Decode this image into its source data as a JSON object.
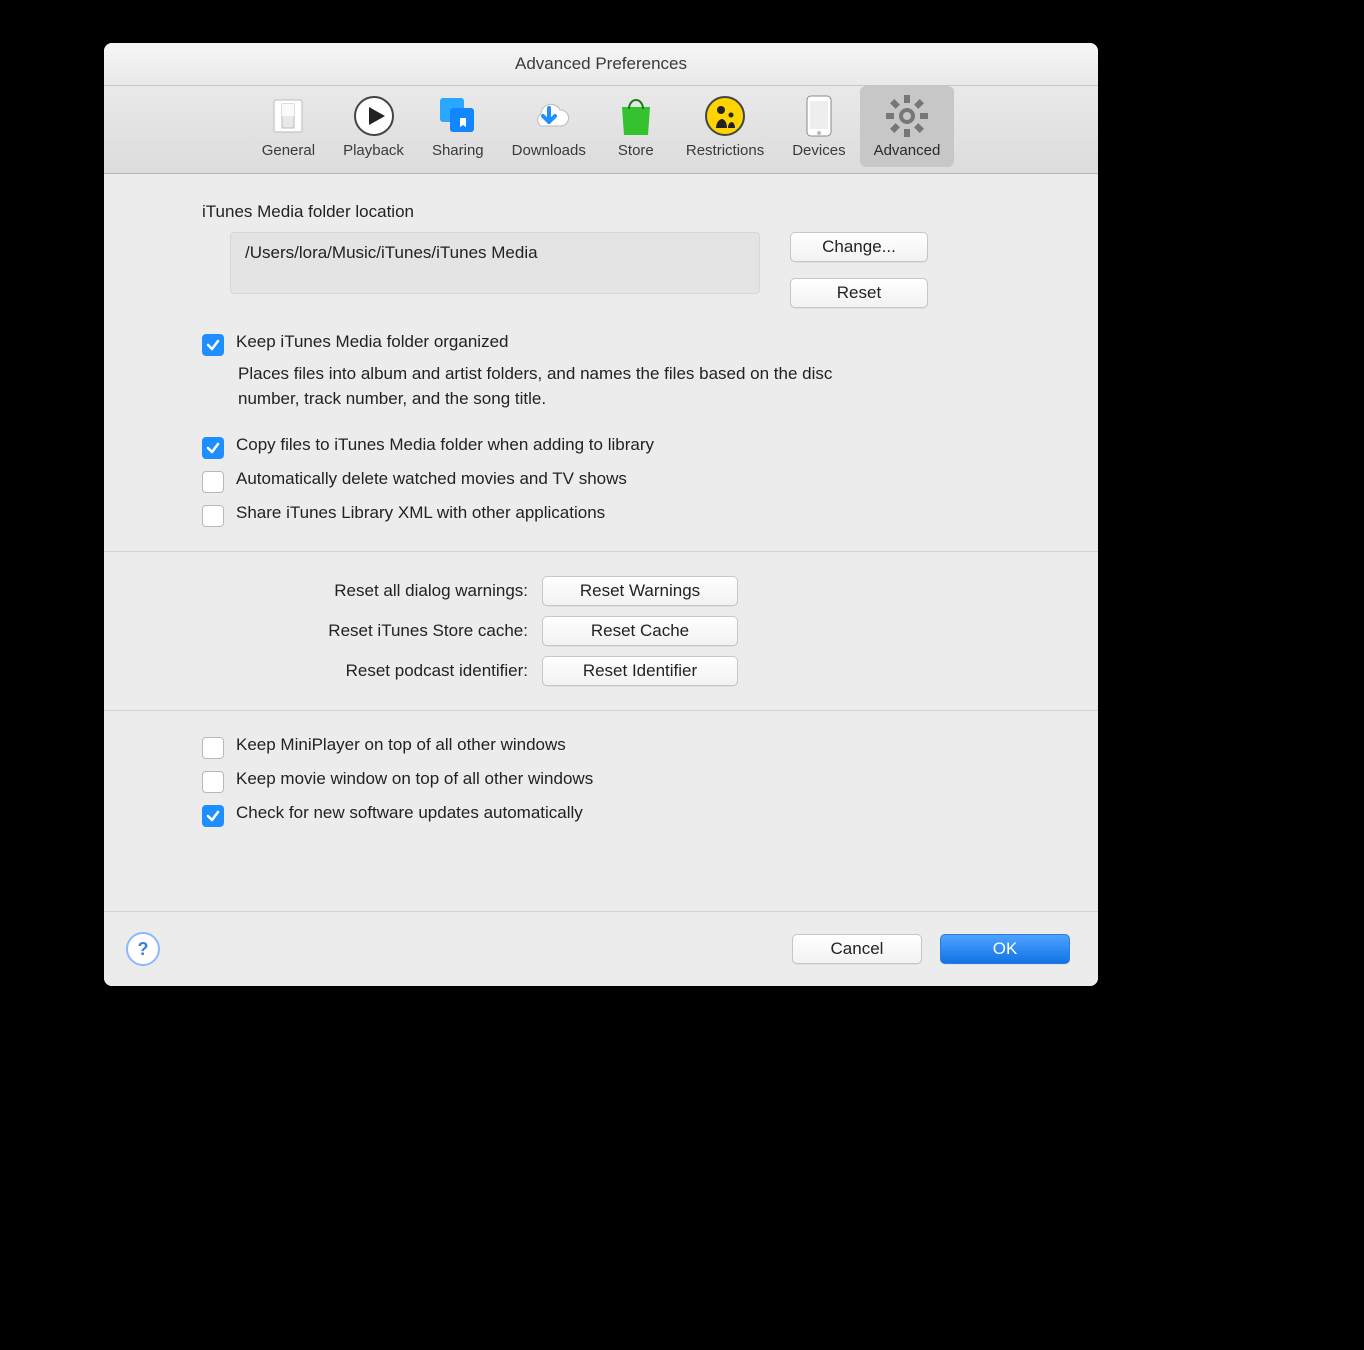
{
  "window": {
    "title": "Advanced Preferences"
  },
  "tabs": [
    {
      "label": "General"
    },
    {
      "label": "Playback"
    },
    {
      "label": "Sharing"
    },
    {
      "label": "Downloads"
    },
    {
      "label": "Store"
    },
    {
      "label": "Restrictions"
    },
    {
      "label": "Devices"
    },
    {
      "label": "Advanced"
    }
  ],
  "active_tab": "Advanced",
  "media": {
    "heading": "iTunes Media folder location",
    "path": "/Users/lora/Music/iTunes/iTunes Media",
    "change_label": "Change...",
    "reset_label": "Reset"
  },
  "options": {
    "organized": {
      "checked": true,
      "label": "Keep iTunes Media folder organized",
      "desc": "Places files into album and artist folders, and names the files based on the disc number, track number, and the song title."
    },
    "copy": {
      "checked": true,
      "label": "Copy files to iTunes Media folder when adding to library"
    },
    "auto_delete": {
      "checked": false,
      "label": "Automatically delete watched movies and TV shows"
    },
    "share_xml": {
      "checked": false,
      "label": "Share iTunes Library XML with other applications"
    }
  },
  "resets": {
    "warnings": {
      "label": "Reset all dialog warnings:",
      "button": "Reset Warnings"
    },
    "cache": {
      "label": "Reset iTunes Store cache:",
      "button": "Reset Cache"
    },
    "identifier": {
      "label": "Reset podcast identifier:",
      "button": "Reset Identifier"
    }
  },
  "window_opts": {
    "miniplayer": {
      "checked": false,
      "label": "Keep MiniPlayer on top of all other windows"
    },
    "movie": {
      "checked": false,
      "label": "Keep movie window on top of all other windows"
    },
    "updates": {
      "checked": true,
      "label": "Check for new software updates automatically"
    }
  },
  "footer": {
    "help": "?",
    "cancel": "Cancel",
    "ok": "OK"
  },
  "colors": {
    "accent": "#1f8fff"
  }
}
